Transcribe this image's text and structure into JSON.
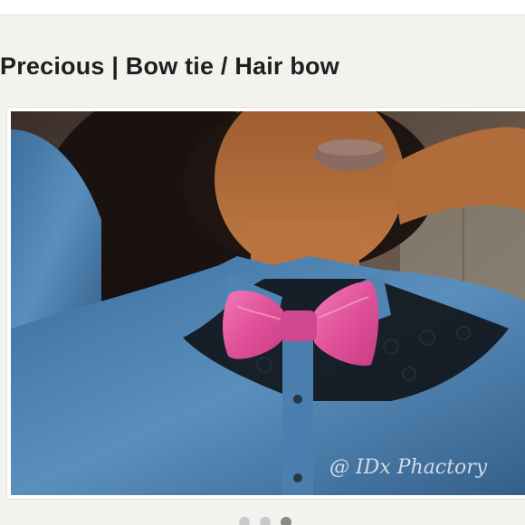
{
  "listing": {
    "title": "Precious | Bow tie / Hair bow"
  },
  "photo": {
    "watermark": "@ IDx Phactory"
  },
  "carousel": {
    "count": 3,
    "active_index": 2
  },
  "colors": {
    "page_background": "#f2f2ef",
    "bow_pink": "#e0529a",
    "denim_blue": "#4a7fb0",
    "dot_inactive": "#c9c9c9",
    "dot_active": "#8a8a8a"
  }
}
